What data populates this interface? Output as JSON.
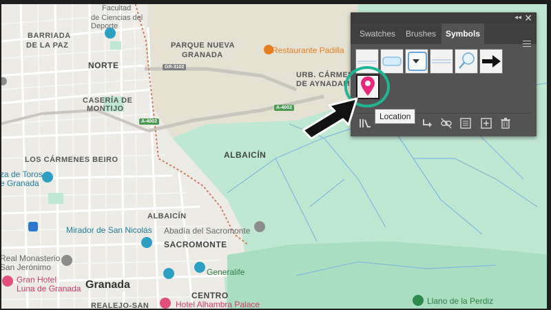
{
  "map": {
    "labels": {
      "facultad": "Facultad",
      "ciencias": "de Ciencias del Deporte",
      "barriada": "BARRIADA",
      "de_la_paz": "DE LA PAZ",
      "parque_nueva": "PARQUE NUEVA",
      "granada_area": "GRANADA",
      "restaurante": "Restaurante Padilla",
      "norte": "NORTE",
      "urb_carmen": "URB. CÁRMEN",
      "de_aynadam": "DE AYNADAM",
      "caseria": "CASERÍA DE",
      "montijo": "MONTIJO",
      "albaicin_big": "ALBAICÍN",
      "los_carmenes": "LOS CÁRMENES BEIRO",
      "plaza_toros": "za de Toros",
      "plaza_granada": "e Granada",
      "albaicin_small": "ALBAICÍN",
      "mirador": "Mirador de San Nicolás",
      "abadia": "Abadía del Sacromonte",
      "sacromonte": "SACROMONTE",
      "real_monasterio": "Real Monasterio",
      "san_jeronimo": "San Jerónimo",
      "hotel_luna_1": "Gran Hotel",
      "hotel_luna_2": "Luna de Granada",
      "granada_city": "Granada",
      "generalife": "Generalife",
      "centro": "CENTRO",
      "realejo": "REALEJO-SAN",
      "hotel_alhambra": "Hotel Alhambra Palace",
      "llano": "Llano de la Perdiz"
    },
    "roads": {
      "gr3102": "GR-3102",
      "a4002_left": "A-4002",
      "a4002_right": "A-4002"
    }
  },
  "panel": {
    "tabs": [
      {
        "label": "Swatches",
        "active": false
      },
      {
        "label": "Brushes",
        "active": false
      },
      {
        "label": "Symbols",
        "active": true
      }
    ],
    "close_glyph": "✕",
    "collapse_glyph": "◂◂",
    "symbols": [
      {
        "icon": "horizontal-line-symbol"
      },
      {
        "icon": "blue-bar-symbol"
      },
      {
        "icon": "dropdown-button-symbol"
      },
      {
        "icon": "double-line-symbol"
      },
      {
        "icon": "magnifier-symbol"
      },
      {
        "icon": "arrow-symbol"
      },
      {
        "icon": "location-pin-symbol",
        "selected": true
      }
    ],
    "tooltip": "Location",
    "toolbar": [
      "libraries-icon",
      "place-symbol-icon",
      "break-link-icon",
      "symbol-options-icon",
      "new-symbol-icon",
      "delete-icon"
    ]
  },
  "colors": {
    "panel_bg": "#535353",
    "tab_bg": "#3f3f3f",
    "highlight_ring": "#20b595",
    "pin": "#e8277a",
    "map_green": "#bfe8d2",
    "map_base": "#eceae4"
  }
}
